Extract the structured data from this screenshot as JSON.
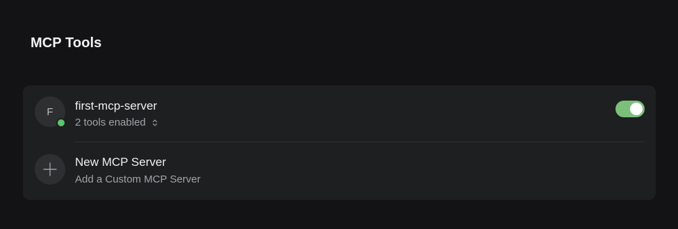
{
  "section": {
    "title": "MCP Tools"
  },
  "servers": [
    {
      "avatar_letter": "F",
      "name": "first-mcp-server",
      "tools_summary": "2 tools enabled",
      "status": "online",
      "status_color": "#5cc46d",
      "enabled": true,
      "toggle_color": "#7cbf7b"
    }
  ],
  "new_server": {
    "title": "New MCP Server",
    "subtitle": "Add a Custom MCP Server",
    "icon": "plus-icon"
  },
  "colors": {
    "background": "#131315",
    "card": "#1e1f20",
    "accent_green": "#7cbf7b"
  }
}
